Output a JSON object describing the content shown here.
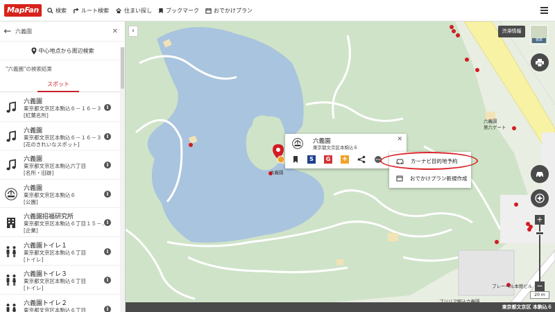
{
  "header": {
    "logo": "MapFan",
    "nav": [
      {
        "label": "検索",
        "icon": "search-icon"
      },
      {
        "label": "ルート検索",
        "icon": "route-icon"
      },
      {
        "label": "住まい探し",
        "icon": "house-icon"
      },
      {
        "label": "ブックマーク",
        "icon": "bookmark-icon"
      },
      {
        "label": "おでかけプラン",
        "icon": "calendar-icon"
      }
    ]
  },
  "sidebar": {
    "search_value": "六義園",
    "around_label": "中心地点から周辺検索",
    "result_heading": "\"六義園\"の検索結果",
    "tab_label": "スポット",
    "results": [
      {
        "name": "六義園",
        "address": "東京都文京区本駒込６－１６－３",
        "category": "[紅葉名所]",
        "icon": "music-note-icon"
      },
      {
        "name": "六義園",
        "address": "東京都文京区本駒込６－１６－３",
        "category": "[花のきれいなスポット]",
        "icon": "music-note-icon"
      },
      {
        "name": "六義園",
        "address": "東京都文京区本駒込六丁目",
        "category": "[名所・旧跡]",
        "icon": "music-note-icon"
      },
      {
        "name": "六義園",
        "address": "東京都文京区本駒込６",
        "category": "[公園]",
        "icon": "fountain-icon"
      },
      {
        "name": "六義園招福研究所",
        "address": "東京都文京区本駒込６丁目１５－．．．",
        "category": "[企業]",
        "icon": "building-icon"
      },
      {
        "name": "六義園トイレ１",
        "address": "東京都文京区本駒込６丁目",
        "category": "[トイレ]",
        "icon": "toilet-icon"
      },
      {
        "name": "六義園トイレ３",
        "address": "東京都文京区本駒込６丁目",
        "category": "[トイレ]",
        "icon": "toilet-icon"
      },
      {
        "name": "六義園トイレ２",
        "address": "東京都文京区本駒込６丁目",
        "category": "",
        "icon": "toilet-icon"
      }
    ]
  },
  "map": {
    "traffic_label": "渋滞情報",
    "thumb_label": "標準",
    "scale_label": "20 m",
    "address_bar": "東京都文京区 本駒込６",
    "labels": {
      "garden_pin": "六義園",
      "east": "六義園\n第六ゲート",
      "building": "ブレーベル本館ビル",
      "bottom": "プリリア駒込六義園"
    },
    "popup": {
      "name": "六義園",
      "address": "東京都文京区本駒込６"
    },
    "context_menu": {
      "items": [
        "カーナビ目的地予約",
        "おでかけプラン新規作成"
      ]
    },
    "colors": {
      "water": "#a9c4de",
      "grass": "#cfe3c8",
      "path": "#ffffff",
      "road": "#f8f3a4",
      "pin": "#d31c24"
    }
  }
}
